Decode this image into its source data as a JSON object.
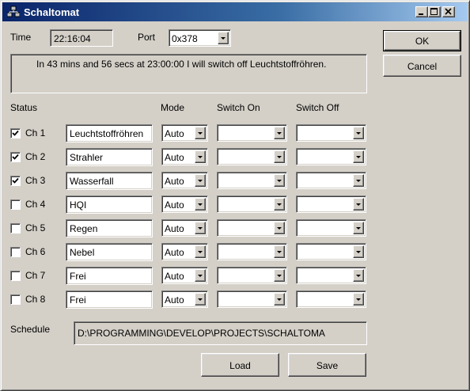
{
  "window": {
    "title": "Schaltomat",
    "icon": "network-app-icon",
    "controls": [
      "minimize-icon",
      "maximize-icon",
      "close-icon"
    ]
  },
  "time": {
    "label": "Time",
    "value": "22:16:04"
  },
  "port": {
    "label": "Port",
    "value": "0x378"
  },
  "message": "In 43 mins and 56 secs at 23:00:00 I will switch off Leuchtstoffröhren.",
  "headers": {
    "status": "Status",
    "mode": "Mode",
    "switch_on": "Switch On",
    "switch_off": "Switch Off"
  },
  "channels": [
    {
      "label": "Ch 1",
      "checked": true,
      "name": "Leuchtstoffröhren",
      "mode": "Auto",
      "switch_on": "",
      "switch_off": ""
    },
    {
      "label": "Ch 2",
      "checked": true,
      "name": "Strahler",
      "mode": "Auto",
      "switch_on": "",
      "switch_off": ""
    },
    {
      "label": "Ch 3",
      "checked": true,
      "name": "Wasserfall",
      "mode": "Auto",
      "switch_on": "",
      "switch_off": ""
    },
    {
      "label": "Ch 4",
      "checked": false,
      "name": "HQI",
      "mode": "Auto",
      "switch_on": "",
      "switch_off": ""
    },
    {
      "label": "Ch 5",
      "checked": false,
      "name": "Regen",
      "mode": "Auto",
      "switch_on": "",
      "switch_off": ""
    },
    {
      "label": "Ch 6",
      "checked": false,
      "name": "Nebel",
      "mode": "Auto",
      "switch_on": "",
      "switch_off": ""
    },
    {
      "label": "Ch 7",
      "checked": false,
      "name": "Frei",
      "mode": "Auto",
      "switch_on": "",
      "switch_off": ""
    },
    {
      "label": "Ch 8",
      "checked": false,
      "name": "Frei",
      "mode": "Auto",
      "switch_on": "",
      "switch_off": ""
    }
  ],
  "schedule": {
    "label": "Schedule",
    "value": "D:\\PROGRAMMING\\DEVELOP\\PROJECTS\\SCHALTOMA"
  },
  "buttons": {
    "ok": "OK",
    "cancel": "Cancel",
    "load": "Load",
    "save": "Save"
  }
}
